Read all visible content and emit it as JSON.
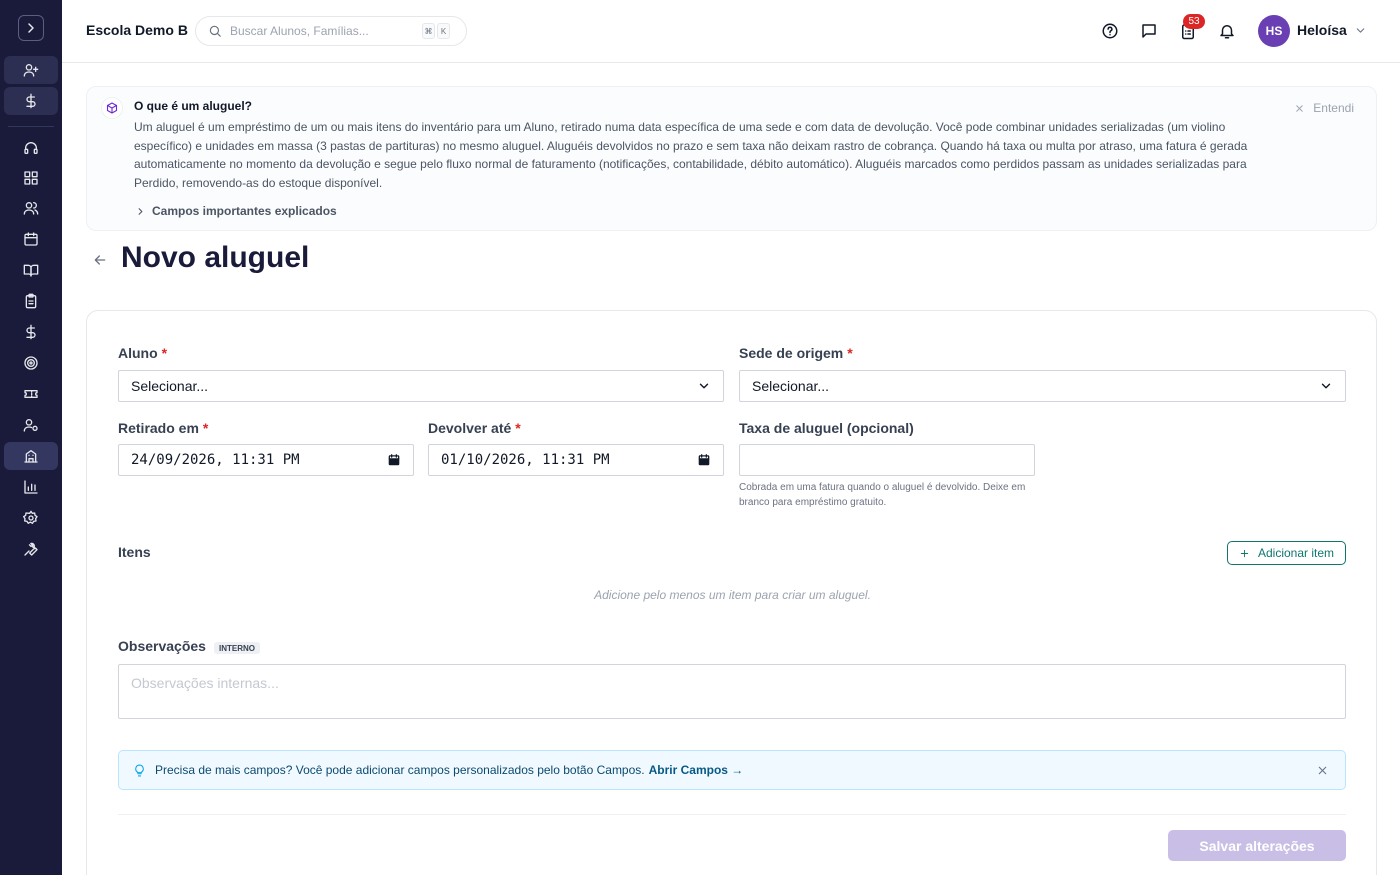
{
  "header": {
    "school_name": "Escola Demo B",
    "search_placeholder": "Buscar Alunos, Famílias...",
    "kbd_1": "⌘",
    "kbd_2": "K",
    "tasks_badge": "53",
    "user_initials": "HS",
    "user_name": "Heloísa"
  },
  "info_banner": {
    "title": "O que é um aluguel?",
    "body": "Um aluguel é um empréstimo de um ou mais itens do inventário para um Aluno, retirado numa data específica de uma sede e com data de devolução. Você pode combinar unidades serializadas (um violino específico) e unidades em massa (3 pastas de partituras) no mesmo aluguel. Aluguéis devolvidos no prazo e sem taxa não deixam rastro de cobrança. Quando há taxa ou multa por atraso, uma fatura é gerada automaticamente no momento da devolução e segue pelo fluxo normal de faturamento (notificações, contabilidade, débito automático). Aluguéis marcados como perdidos passam as unidades serializadas para Perdido, removendo-as do estoque disponível.",
    "expand_label": "Campos importantes explicados",
    "dismiss_label": "Entendi"
  },
  "page": {
    "title": "Novo aluguel"
  },
  "form": {
    "student_label": "Aluno",
    "student_value": "Selecionar...",
    "origin_label": "Sede de origem",
    "origin_value": "Selecionar...",
    "required_mark": "*",
    "checkout_label": "Retirado em",
    "checkout_value": "24/09/2026, 11:31 PM",
    "return_label": "Devolver até",
    "return_value": "01/10/2026, 11:31 PM",
    "fee_label": "Taxa de aluguel (opcional)",
    "fee_value": "",
    "fee_help": "Cobrada em uma fatura quando o aluguel é devolvido. Deixe em branco para empréstimo gratuito.",
    "items_label": "Itens",
    "add_item_label": "Adicionar item",
    "items_empty": "Adicione pelo menos um item para criar um aluguel.",
    "notes_label": "Observações",
    "notes_tag": "INTERNO",
    "notes_placeholder": "Observações internas...",
    "tip_text": "Precisa de mais campos? Você pode adicionar campos personalizados pelo botão Campos.",
    "tip_link": "Abrir Campos →",
    "save_label": "Salvar alterações"
  },
  "colors": {
    "sidebar_bg": "#1a1b3a",
    "accent": "#0f766e",
    "avatar": "#6a3fb3",
    "badge": "#dc2626",
    "save_disabled": "#c9bfe6"
  }
}
